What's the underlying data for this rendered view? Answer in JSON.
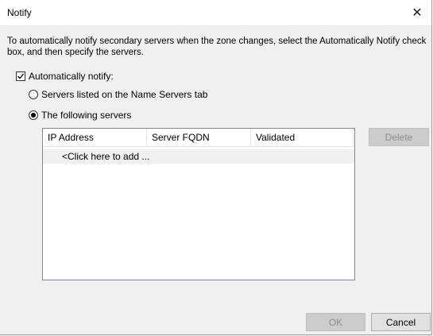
{
  "window": {
    "title": "Notify",
    "close_glyph": "✕"
  },
  "description": "To automatically notify secondary servers when the zone changes, select the Automatically Notify check box, and then specify the servers.",
  "auto_notify": {
    "label": "Automatically notify:",
    "checked": true
  },
  "radio_options": [
    {
      "label": "Servers listed on the Name Servers tab",
      "selected": false
    },
    {
      "label": "The following servers",
      "selected": true
    }
  ],
  "server_list": {
    "columns": [
      "IP Address",
      "Server FQDN",
      "Validated"
    ],
    "add_row_text": "<Click here to add ..."
  },
  "buttons": {
    "delete": "Delete",
    "ok": "OK",
    "cancel": "Cancel"
  }
}
